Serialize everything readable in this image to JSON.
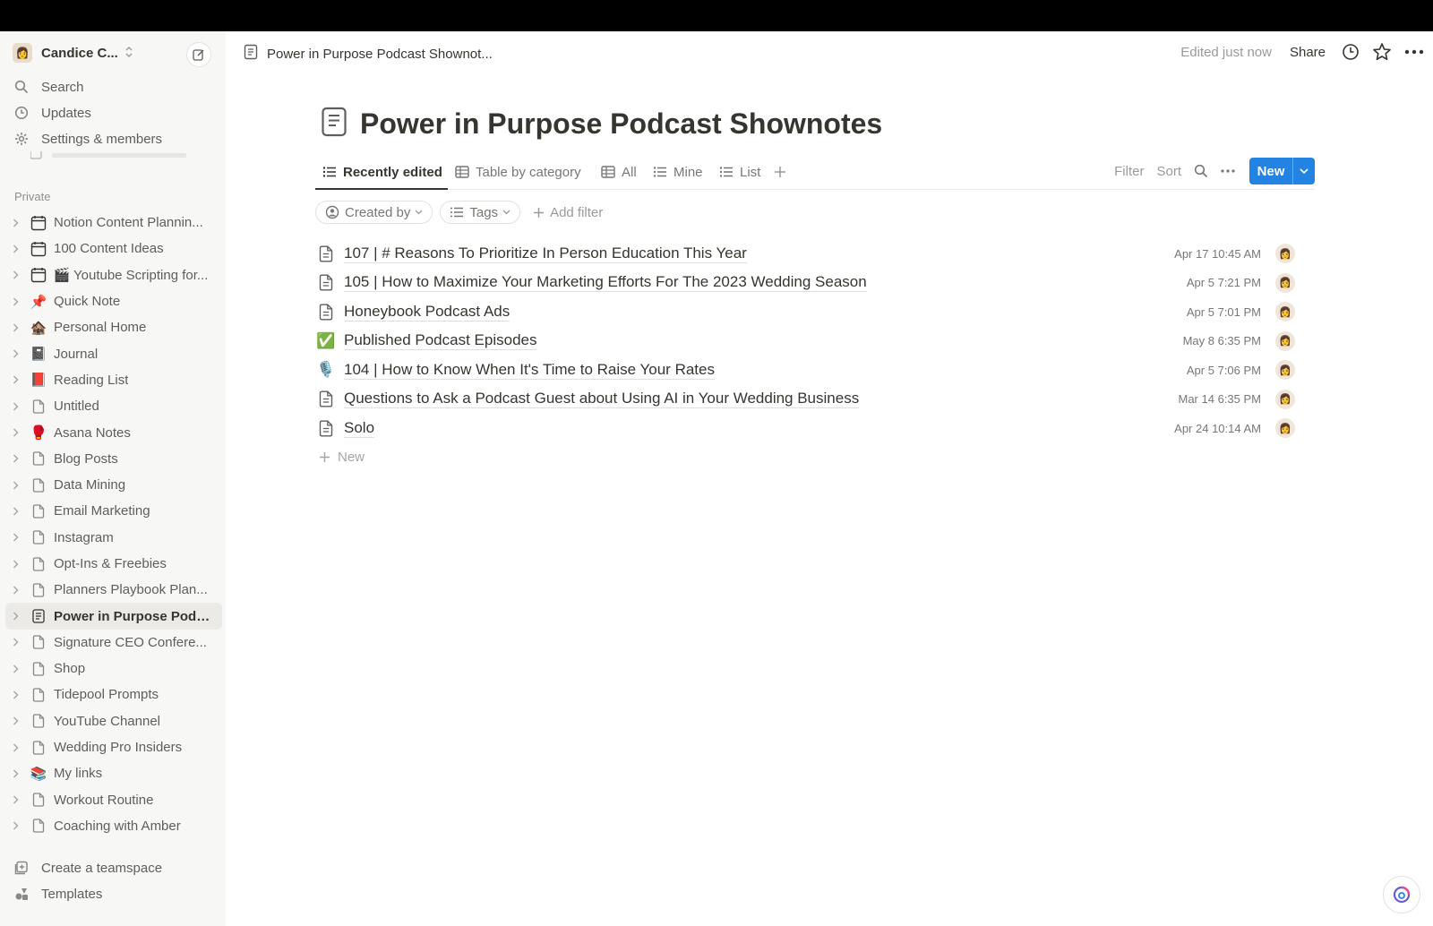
{
  "workspace": {
    "name": "Candice C..."
  },
  "sidebar": {
    "top_items": [
      {
        "icon": "search-icon",
        "label": "Search"
      },
      {
        "icon": "clock-icon",
        "label": "Updates"
      },
      {
        "icon": "gear-icon",
        "label": "Settings & members"
      }
    ],
    "section_label": "Private",
    "pages": [
      {
        "icon": "calendar-icon",
        "label": "Notion Content Plannin..."
      },
      {
        "icon": "calendar-icon",
        "label": "100 Content Ideas"
      },
      {
        "icon": "calendar-icon",
        "emoji": "🎬",
        "label": "Youtube Scripting for..."
      },
      {
        "emoji": "📌",
        "label": "Quick Note"
      },
      {
        "emoji": "🏚️",
        "label": "Personal Home"
      },
      {
        "emoji": "📓",
        "label": "Journal"
      },
      {
        "emoji": "📕",
        "label": "Reading List"
      },
      {
        "icon": "page-icon",
        "label": "Untitled"
      },
      {
        "emoji": "🥊",
        "label": "Asana Notes"
      },
      {
        "icon": "page-icon",
        "label": "Blog Posts"
      },
      {
        "icon": "page-icon",
        "label": "Data Mining"
      },
      {
        "icon": "page-icon",
        "label": "Email Marketing"
      },
      {
        "icon": "page-icon",
        "label": "Instagram"
      },
      {
        "icon": "page-icon",
        "label": "Opt-Ins & Freebies"
      },
      {
        "icon": "page-icon",
        "label": "Planners Playbook Plan..."
      },
      {
        "icon": "doc-icon",
        "label": "Power in Purpose Podc...",
        "active": true
      },
      {
        "icon": "page-icon",
        "label": "Signature CEO Confere..."
      },
      {
        "icon": "page-icon",
        "label": "Shop"
      },
      {
        "icon": "page-icon",
        "label": "Tidepool Prompts"
      },
      {
        "icon": "page-icon",
        "label": "YouTube Channel"
      },
      {
        "icon": "page-icon",
        "label": "Wedding Pro Insiders"
      },
      {
        "emoji": "📚",
        "label": "My links"
      },
      {
        "icon": "page-icon",
        "label": "Workout Routine"
      },
      {
        "icon": "page-icon",
        "label": "Coaching with Amber"
      }
    ],
    "bottom_items": [
      {
        "icon": "teamspace-icon",
        "label": "Create a teamspace"
      },
      {
        "icon": "templates-icon",
        "label": "Templates"
      }
    ]
  },
  "header": {
    "breadcrumb": "Power in Purpose Podcast Shownot...",
    "edited": "Edited just now",
    "share": "Share"
  },
  "page": {
    "title": "Power in Purpose Podcast Shownotes",
    "tabs": [
      {
        "icon": "list-icon",
        "label": "Recently edited",
        "active": true
      },
      {
        "icon": "table-icon",
        "label": "Table by category"
      },
      {
        "icon": "table-icon",
        "label": "All"
      },
      {
        "icon": "list-icon",
        "label": "Mine"
      },
      {
        "icon": "list-icon",
        "label": "List"
      }
    ],
    "tools": {
      "filter": "Filter",
      "sort": "Sort",
      "new": "New"
    },
    "filters": {
      "created_by": "Created by",
      "tags": "Tags",
      "add_filter": "Add filter"
    },
    "rows": [
      {
        "icon": "page-icon",
        "title": "107 | # Reasons To Prioritize In Person Education This Year",
        "date": "Apr 17 10:45 AM"
      },
      {
        "icon": "page-icon",
        "title": "105 | How to Maximize Your Marketing Efforts For The 2023 Wedding Season",
        "date": "Apr 5 7:21 PM"
      },
      {
        "icon": "page-icon",
        "title": "Honeybook Podcast Ads",
        "date": "Apr 5 7:01 PM"
      },
      {
        "icon": "check-icon",
        "emoji": "✅",
        "title": "Published Podcast Episodes",
        "date": "May 8 6:35 PM"
      },
      {
        "icon": "microphone-icon",
        "emoji": "🎙️",
        "title": "104 | How to Know When It's Time to Raise Your Rates",
        "date": "Apr 5 7:06 PM"
      },
      {
        "icon": "page-icon",
        "title": "Questions to Ask a Podcast Guest about Using AI in Your Wedding Business",
        "date": "Mar 14 6:35 PM"
      },
      {
        "icon": "page-icon",
        "title": "Solo",
        "date": "Apr 24 10:14 AM"
      }
    ],
    "add_row": "New"
  },
  "colors": {
    "accent": "#2383e2",
    "sidebar_bg": "#f7f7f5",
    "text": "#37352f"
  }
}
